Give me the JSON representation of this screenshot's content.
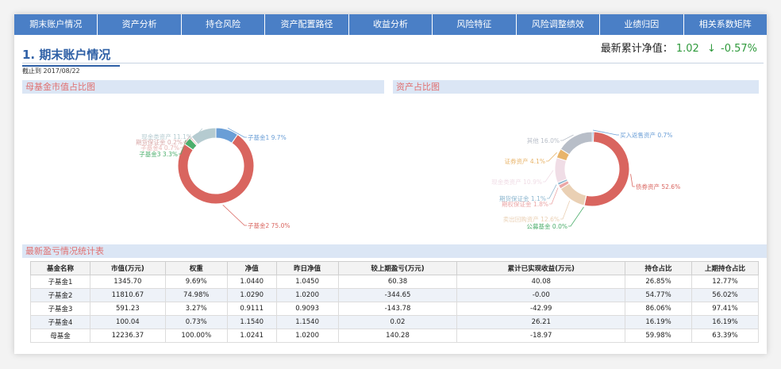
{
  "nav": [
    "期末账户情况",
    "资产分析",
    "持仓风险",
    "资产配置路径",
    "收益分析",
    "风险特征",
    "风险调整绩效",
    "业绩归因",
    "相关系数矩阵"
  ],
  "page": {
    "title": "1. 期末账户情况",
    "as_of": "截止到 2017/08/22",
    "nav_label": "最新累计净值：",
    "nav_value": "1.02",
    "nav_change": "-0.57%",
    "change_color": "#2f9a3c"
  },
  "sections": {
    "fund_share": "母基金市值占比图",
    "asset_share": "资产占比图",
    "pnl_table": "最新盈亏情况统计表"
  },
  "chart_data": [
    {
      "type": "pie",
      "title": "母基金市值占比图",
      "labels": [
        "子基金1",
        "子基金2",
        "子基金3",
        "子基金4",
        "期货保证金",
        "现金类资产"
      ],
      "values": [
        9.7,
        75.0,
        3.3,
        0.7,
        0.2,
        11.1
      ],
      "label_texts": [
        "子基金1 9.7%",
        "子基金2 75.0%",
        "子基金3 3.3%",
        "子基金4 0.7%",
        "期货保证金 0.2%",
        "现金类资产 11.1%"
      ],
      "colors": [
        "#6a9ed6",
        "#d9655f",
        "#4cae6c",
        "#e8b6b4",
        "#d8a8a8",
        "#b5cbd0"
      ]
    },
    {
      "type": "pie",
      "title": "资产占比图",
      "labels": [
        "买入返售资产",
        "债券资产",
        "公募基金",
        "卖出回购资产",
        "期权保证金",
        "期货保证金",
        "现金类资产",
        "证券资产",
        "其他"
      ],
      "values": [
        0.7,
        52.6,
        0.0,
        12.6,
        1.8,
        1.1,
        10.9,
        4.1,
        16.0
      ],
      "label_texts": [
        "买入返售资产 0.7%",
        "债券资产 52.6%",
        "公募基金 0.0%",
        "卖出回购资产 12.6%",
        "期权保证金 1.8%",
        "期货保证金 1.1%",
        "现金类资产 10.9%",
        "证券资产 4.1%",
        "其他 16.0%"
      ],
      "colors": [
        "#6a9ed6",
        "#d9655f",
        "#4cae6c",
        "#ead0b4",
        "#eba6a6",
        "#8fb8d0",
        "#f0dde6",
        "#e8b46a",
        "#b8bec8"
      ]
    }
  ],
  "table": {
    "headers": [
      "基金名称",
      "市值(万元)",
      "权重",
      "净值",
      "昨日净值",
      "较上期盈亏(万元)",
      "累计已实现收益(万元)",
      "持仓占比",
      "上期持仓占比"
    ],
    "rows": [
      [
        "子基金1",
        "1345.70",
        "9.69%",
        "1.0440",
        "1.0450",
        "60.38",
        "40.08",
        "26.85%",
        "12.77%"
      ],
      [
        "子基金2",
        "11810.67",
        "74.98%",
        "1.0290",
        "1.0200",
        "-344.65",
        "-0.00",
        "54.77%",
        "56.02%"
      ],
      [
        "子基金3",
        "591.23",
        "3.27%",
        "0.9111",
        "0.9093",
        "-143.78",
        "-42.99",
        "86.06%",
        "97.41%"
      ],
      [
        "子基金4",
        "100.04",
        "0.73%",
        "1.1540",
        "1.1540",
        "0.02",
        "26.21",
        "16.19%",
        "16.19%"
      ],
      [
        "母基金",
        "12236.37",
        "100.00%",
        "1.0241",
        "1.0200",
        "140.28",
        "-18.97",
        "59.98%",
        "63.39%"
      ]
    ]
  }
}
